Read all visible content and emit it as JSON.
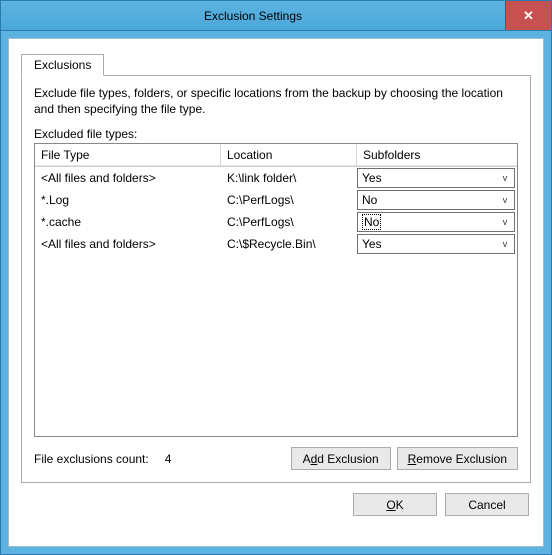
{
  "window": {
    "title": "Exclusion Settings",
    "close_glyph": "✕"
  },
  "tab": {
    "label": "Exclusions"
  },
  "description": "Exclude file types, folders, or specific locations from the backup by choosing the location and then specifying the file type.",
  "excluded_label": "Excluded file types:",
  "columns": {
    "file_type": "File Type",
    "location": "Location",
    "subfolders": "Subfolders"
  },
  "rows": [
    {
      "file_type": "<All files and folders>",
      "location": "K:\\link folder\\",
      "subfolders": "Yes",
      "selected": false
    },
    {
      "file_type": "*.Log",
      "location": "C:\\PerfLogs\\",
      "subfolders": "No",
      "selected": false
    },
    {
      "file_type": "*.cache",
      "location": "C:\\PerfLogs\\",
      "subfolders": "No",
      "selected": true
    },
    {
      "file_type": "<All files and folders>",
      "location": "C:\\$Recycle.Bin\\",
      "subfolders": "Yes",
      "selected": false
    }
  ],
  "footer": {
    "count_label": "File exclusions count:",
    "count_value": "4",
    "add_pre": "A",
    "add_u": "d",
    "add_post": "d Exclusion",
    "rem_u": "R",
    "rem_post": "emove Exclusion"
  },
  "buttons": {
    "ok_u": "O",
    "ok_post": "K",
    "cancel": "Cancel"
  }
}
